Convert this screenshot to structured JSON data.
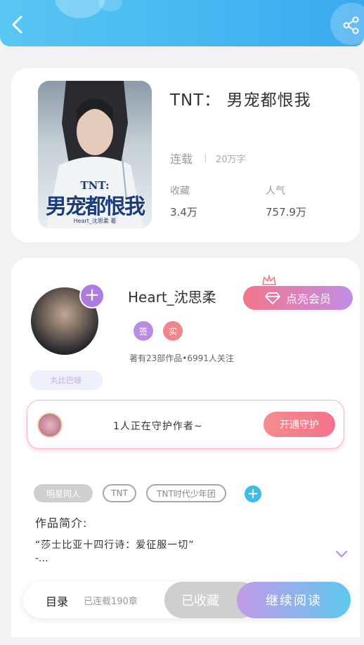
{
  "book": {
    "cover_top_text": "TNT:",
    "cover_title": "男宠都恨我",
    "cover_author": "Heart_沈思柔 著",
    "title": "TNT： 男宠都恨我",
    "status": "连载",
    "word_count": "20万字",
    "collect_label": "收藏",
    "collect_value": "3.4万",
    "popularity_label": "人气",
    "popularity_value": "757.9万"
  },
  "author": {
    "name": "Heart_沈思柔",
    "vip_label": "点亮会员",
    "badge_sign": "签",
    "badge_real": "实",
    "stats": "著有23部作品•6991人关注",
    "sticker": "丸比巴啵"
  },
  "guard": {
    "text": "1人正在守护作者~",
    "button": "开通守护"
  },
  "tags": [
    "明星同人",
    "TNT",
    "TNT时代少年团"
  ],
  "intro": {
    "title": "作品简介:",
    "text": "“莎士比亚十四行诗：爱征服一切”",
    "more": "-..."
  },
  "bottom": {
    "toc": "目录",
    "chapters": "已连载190章",
    "collected": "已收藏",
    "read": "继续阅读"
  },
  "colors": {
    "header": "#3aaaf0",
    "accent_purple": "#b07be0",
    "accent_pink": "#f4728b",
    "accent_blue": "#3fbbe8"
  }
}
